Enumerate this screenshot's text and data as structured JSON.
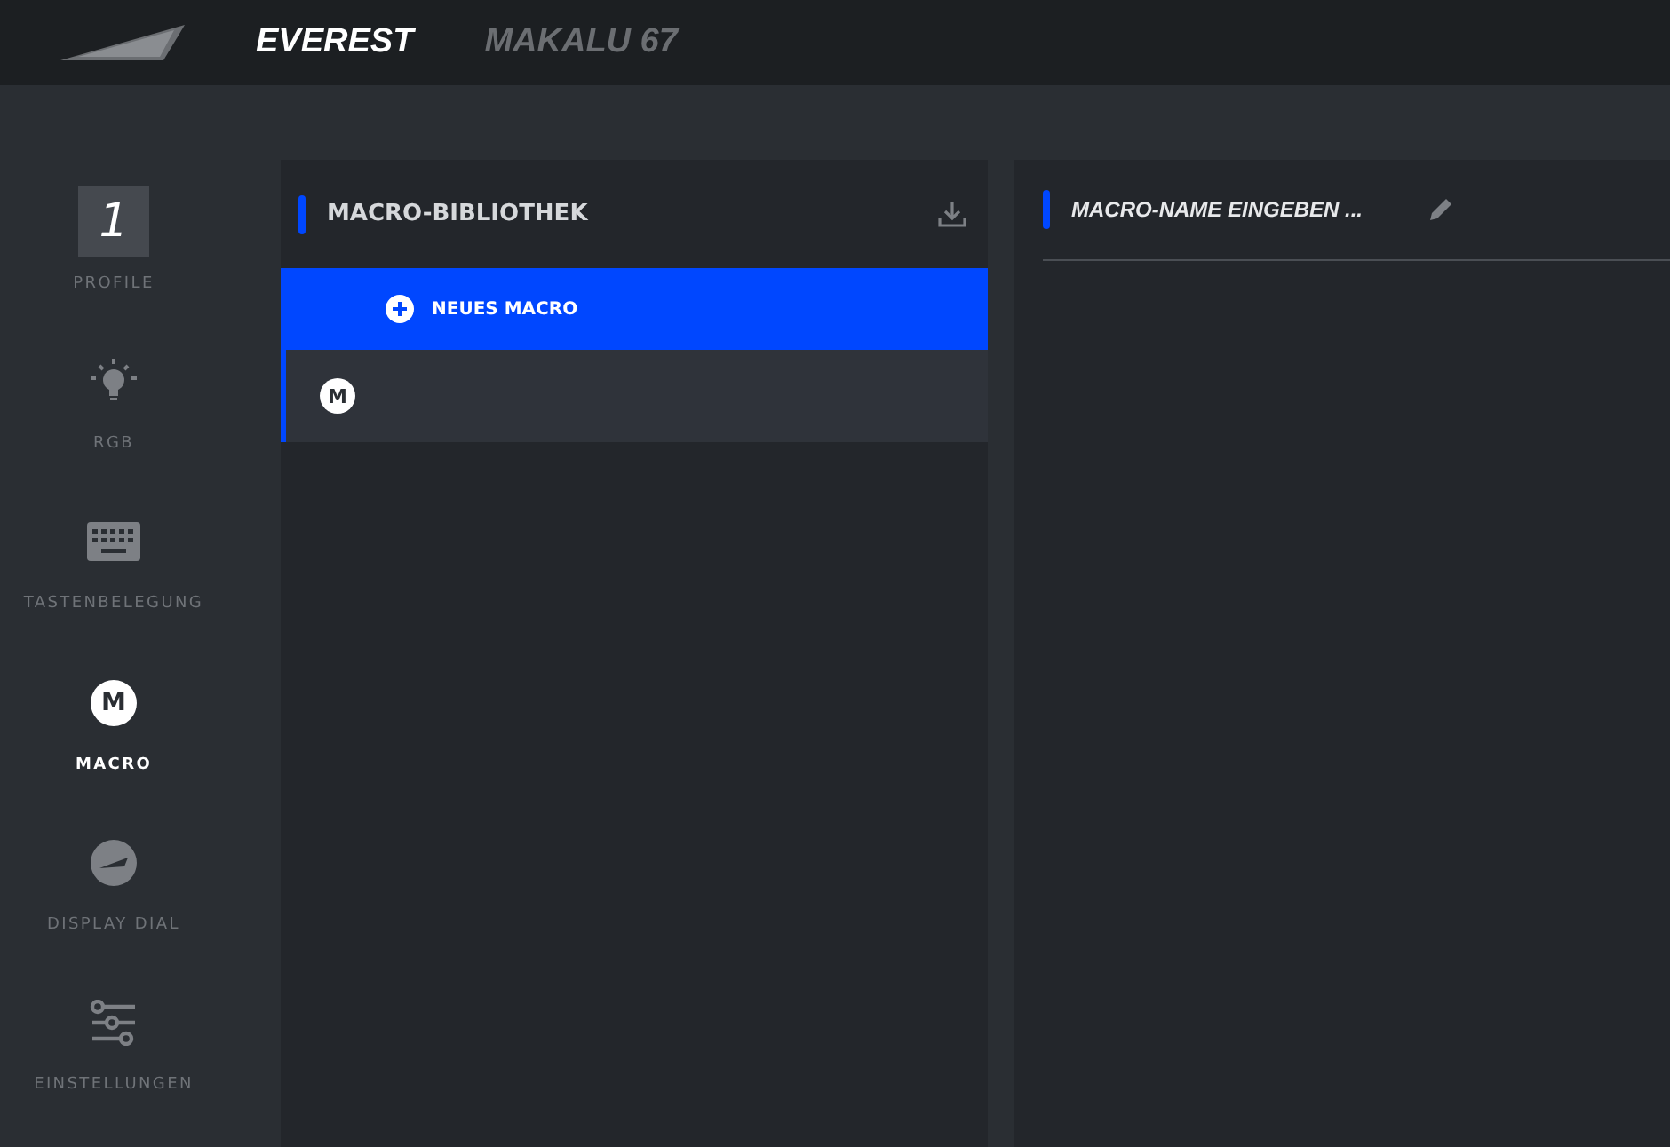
{
  "header": {
    "tabs": [
      {
        "label": "EVEREST",
        "selected": true
      },
      {
        "label": "MAKALU 67",
        "selected": false
      }
    ]
  },
  "sidebar": {
    "items": [
      {
        "kind": "profile",
        "number": "1",
        "label": "PROFILE",
        "selected": false
      },
      {
        "kind": "bulb",
        "label": "RGB",
        "selected": false
      },
      {
        "kind": "keyboard",
        "label": "TASTENBELEGUNG",
        "selected": false
      },
      {
        "kind": "macro",
        "badge": "M",
        "label": "MACRO",
        "selected": true
      },
      {
        "kind": "dial",
        "label": "DISPLAY DIAL",
        "selected": false
      },
      {
        "kind": "sliders",
        "label": "EINSTELLUNGEN",
        "selected": false
      }
    ]
  },
  "library": {
    "title": "MACRO-BIBLIOTHEK",
    "new_button": "NEUES MACRO",
    "macros": [
      {
        "badge": "M",
        "selected": true
      }
    ]
  },
  "editor": {
    "name_field": {
      "placeholder": "MACRO-NAME EINGEBEN ..."
    }
  }
}
